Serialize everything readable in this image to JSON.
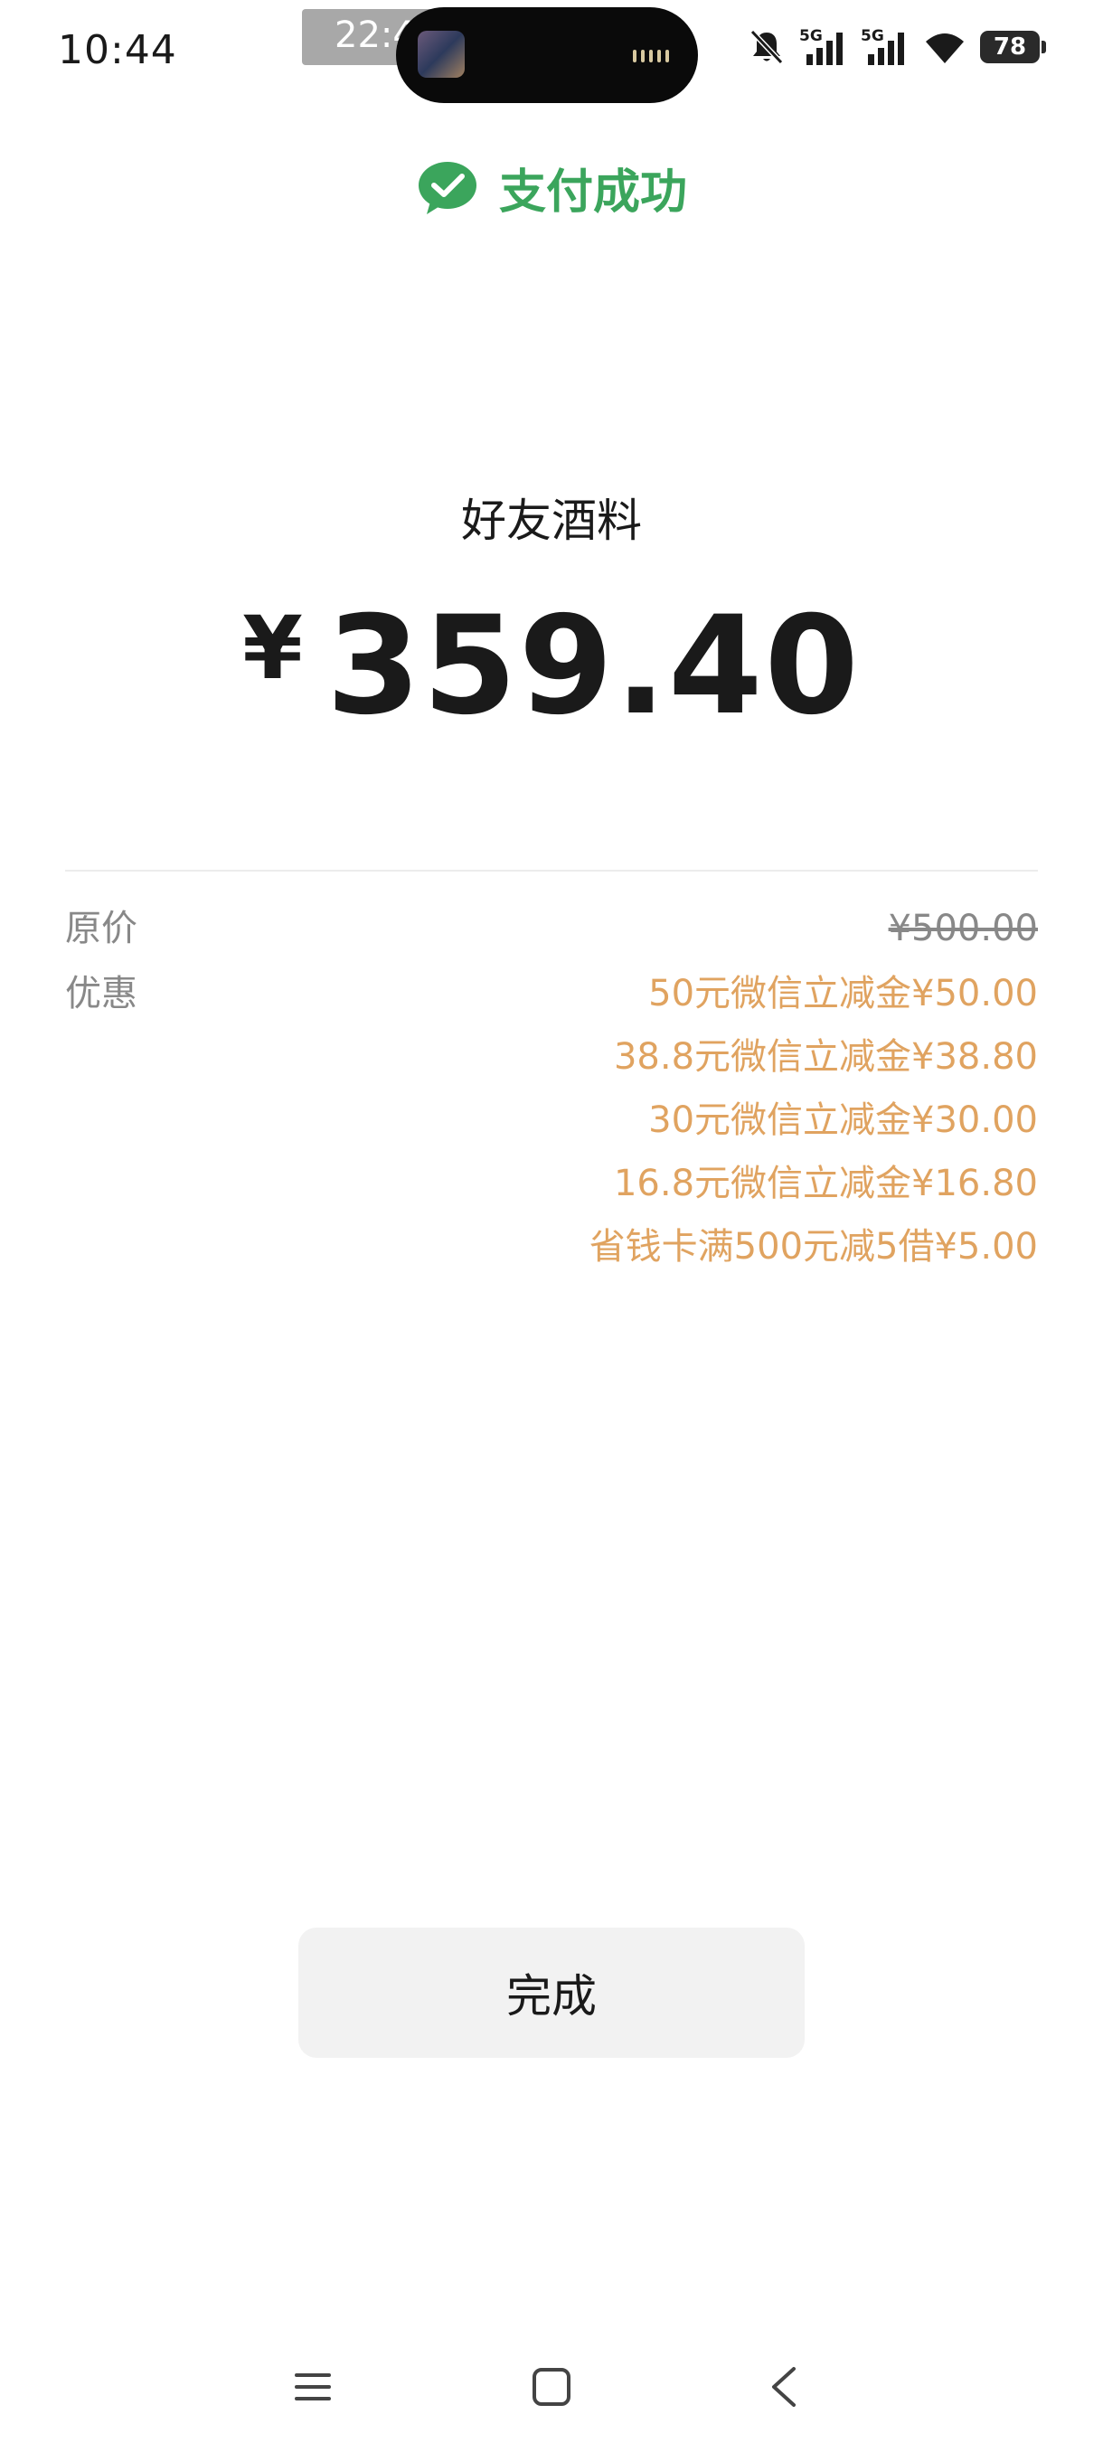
{
  "status_bar": {
    "time": "10:44",
    "floating_time": "22:44:11",
    "network_1": "5G",
    "network_2": "5G",
    "battery": "78"
  },
  "header": {
    "title": "支付成功",
    "icon": "wechat-pay-icon",
    "accent_color": "#3ba55c"
  },
  "payment": {
    "merchant": "好友酒料",
    "currency": "¥",
    "amount": "359.40"
  },
  "details": {
    "original_label": "原价",
    "original_value": "¥500.00",
    "discount_label": "优惠",
    "discount_color": "#e0a360",
    "discounts": [
      "50元微信立减金¥50.00",
      "38.8元微信立减金¥38.80",
      "30元微信立减金¥30.00",
      "16.8元微信立减金¥16.80",
      "省钱卡满500元减5借¥5.00"
    ]
  },
  "done_button": {
    "label": "完成"
  },
  "nav_bar": {
    "icons": [
      "menu-icon",
      "home-icon",
      "back-icon"
    ]
  }
}
